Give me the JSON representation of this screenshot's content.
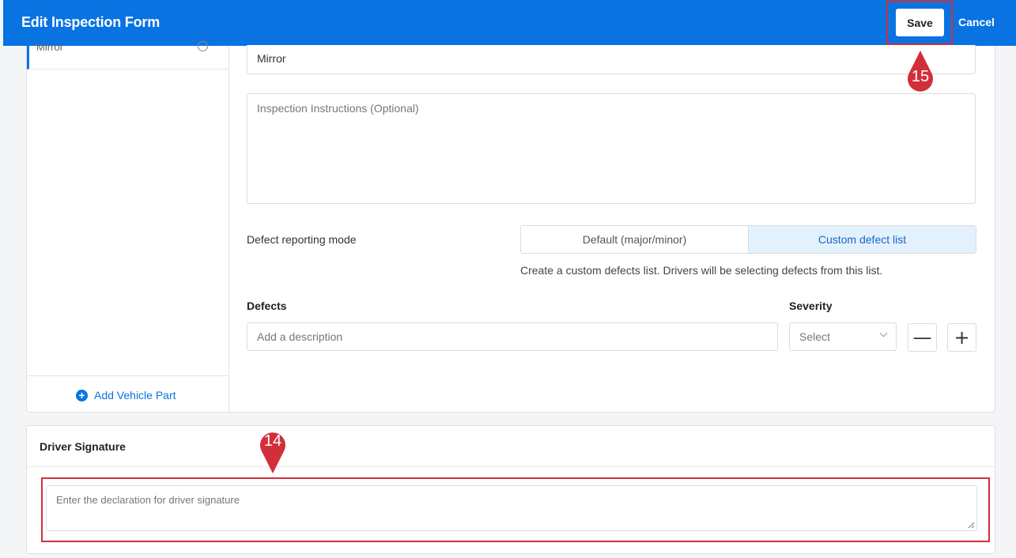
{
  "header": {
    "title": "Edit Inspection Form",
    "save_label": "Save",
    "cancel_label": "Cancel"
  },
  "sidebar": {
    "items": [
      {
        "label": "Mirror",
        "icon": "info-circle-icon"
      }
    ],
    "add_part_label": "Add Vehicle Part"
  },
  "form": {
    "part_name_value": "Mirror",
    "instructions_placeholder": "Inspection Instructions (Optional)",
    "defect_mode_label": "Defect reporting mode",
    "mode_options": [
      "Default (major/minor)",
      "Custom defect list"
    ],
    "mode_selected": "Custom defect list",
    "mode_help": "Create a custom defects list. Drivers will be selecting defects from this list.",
    "defects_header": "Defects",
    "severity_header": "Severity",
    "defect_placeholder": "Add a description",
    "severity_placeholder": "Select",
    "remove_label": "—",
    "add_label": "+"
  },
  "signature": {
    "title": "Driver Signature",
    "placeholder": "Enter the declaration for driver signature"
  },
  "annotations": {
    "marker_signature": "14",
    "marker_save": "15",
    "highlight_color": "#d22f3a"
  },
  "colors": {
    "brand": "#0a73e2",
    "selected_bg": "#e3f1fd"
  }
}
